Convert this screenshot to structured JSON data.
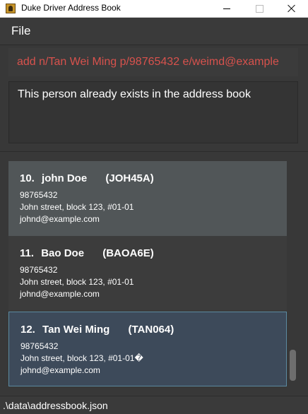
{
  "window": {
    "title": "Duke Driver Address Book"
  },
  "menu": {
    "file_label": "File"
  },
  "command_box": {
    "value": "add n/Tan Wei Ming p/98765432 e/weimd@example"
  },
  "result_display": {
    "message": "This person already exists in the address book"
  },
  "person_list": {
    "cards": [
      {
        "index": "10.",
        "name": "john Doe",
        "tag": "(JOH45A)",
        "phone": "98765432",
        "address": "John street, block 123, #01-01",
        "email": "johnd@example.com",
        "state": "hovered"
      },
      {
        "index": "11.",
        "name": "Bao Doe",
        "tag": "(BAOA6E)",
        "phone": "98765432",
        "address": "John street, block 123, #01-01",
        "email": "johnd@example.com",
        "state": "normal"
      },
      {
        "index": "12.",
        "name": "Tan Wei Ming",
        "tag": "(TAN064)",
        "phone": "98765432",
        "address": "John street, block 123, #01-01�",
        "email": "johnd@example.com",
        "state": "selected"
      }
    ]
  },
  "status_bar": {
    "save_location": ".\\data\\addressbook.json"
  },
  "colors": {
    "background": "#3a3a3a",
    "command_text": "#d8524d",
    "card_hover": "#515658",
    "card_selected": "#3d4a5a",
    "selected_border": "#5b8aa0"
  },
  "icons": {
    "app": "address-book-icon",
    "minimize": "minimize-icon",
    "maximize": "maximize-icon",
    "close": "close-icon"
  }
}
